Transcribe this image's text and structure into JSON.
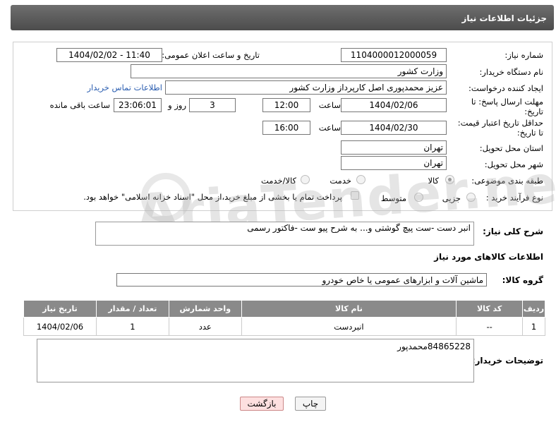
{
  "header": {
    "title": "جزئیات اطلاعات نیاز"
  },
  "form": {
    "need_number_label": "شماره نیاز:",
    "need_number": "1104000012000059",
    "announce_label": "تاریخ و ساعت اعلان عمومی:",
    "announce_value": "1404/02/02 - 11:40",
    "buyer_org_label": "نام دستگاه خریدار:",
    "buyer_org": "وزارت کشور",
    "requester_label": "ایجاد کننده درخواست:",
    "requester": "عزیز محمدپوری اصل کارپرداز وزارت کشور",
    "contact_link": "اطلاعات تماس خریدار",
    "deadline_label_1": "مهلت ارسال پاسخ: تا",
    "deadline_label_2": "تاریخ:",
    "deadline_date": "1404/02/06",
    "time_label": "ساعت",
    "deadline_time": "12:00",
    "days_value": "3",
    "days_label": "روز و",
    "remaining_time": "23:06:01",
    "remaining_label": "ساعت باقی مانده",
    "validity_label_1": "حداقل تاریخ اعتبار قیمت:",
    "validity_label_2": "تا تاریخ:",
    "validity_date": "1404/02/30",
    "validity_time": "16:00",
    "province_label": "استان محل تحویل:",
    "province": "تهران",
    "city_label": "شهر محل تحویل:",
    "city": "تهران",
    "category_label": "طبقه بندی موضوعی:",
    "category_options": [
      "کالا",
      "خدمت",
      "کالا/خدمت"
    ],
    "process_label": "نوع فرآیند خرید :",
    "process_options": [
      "جزیی",
      "متوسط"
    ],
    "payment_note": "پرداخت تمام یا بخشی از مبلغ خرید،از محل \"اسناد خزانه اسلامی\" خواهد بود."
  },
  "summary": {
    "label": "شرح کلی نیاز:",
    "value": "انبر دست -ست پیچ گوشتی و... به شرح پیو ست -فاکتور رسمی"
  },
  "goods": {
    "section_title": "اطلاعات کالاهای مورد نیاز",
    "group_label": "گروه کالا:",
    "group_value": "ماشین آلات و ابزارهای عمومی یا خاص خودرو"
  },
  "table": {
    "headers": [
      "ردیف",
      "کد کالا",
      "نام کالا",
      "واحد شمارش",
      "تعداد / مقدار",
      "تاریخ نیاز"
    ],
    "rows": [
      [
        "1",
        "--",
        "انبردست",
        "عدد",
        "1",
        "1404/02/06"
      ]
    ]
  },
  "buyer_notes": {
    "label": "توضیحات خریدار:",
    "value": "84865228محمدپور"
  },
  "buttons": {
    "print": "چاپ",
    "back": "بازگشت"
  },
  "watermark": {
    "text": "AriaTender.net"
  }
}
